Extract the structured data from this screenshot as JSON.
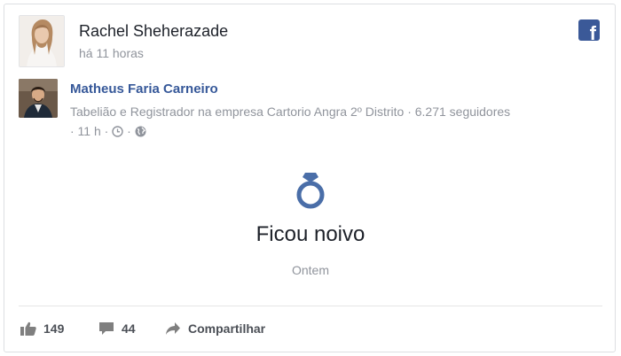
{
  "post": {
    "author_name": "Rachel Sheherazade",
    "time": "há 11 horas"
  },
  "shared": {
    "name": "Matheus Faria Carneiro",
    "description": "Tabelião e Registrador na empresa Cartorio Angra 2º Distrito · 6.271 seguidores",
    "time_prefix": "· 11 h ·",
    "time_separator": "·",
    "privacy_icon": "globe-icon",
    "clock_icon": "clock-icon"
  },
  "event": {
    "icon": "ring-icon",
    "title": "Ficou noivo",
    "date": "Ontem"
  },
  "actions": {
    "like_count": "149",
    "comment_count": "44",
    "share_label": "Compartilhar"
  },
  "colors": {
    "link": "#365899",
    "facebook": "#3b5998",
    "secondary_text": "#90949c",
    "primary_text": "#1d2129"
  }
}
